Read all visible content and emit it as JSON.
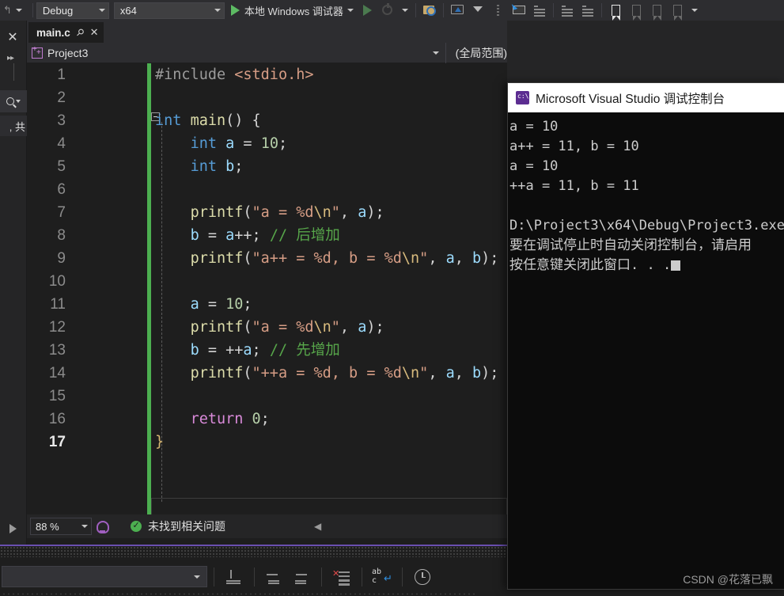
{
  "toolbar": {
    "configuration": "Debug",
    "platform": "x64",
    "debug_target": "本地 Windows 调试器",
    "icons": [
      "undo-icon",
      "redo-caret-icon",
      "start-debug-icon",
      "start-without-debug-icon",
      "stop-icon",
      "find-in-folder-icon",
      "preview-window-icon",
      "filter-icon",
      "more-dots-icon",
      "step-pointer-icon",
      "indent-block-icon",
      "align-left-icon",
      "outdent-icon",
      "bookmark-icon",
      "prev-bookmark-icon",
      "next-bookmark-icon",
      "clear-bookmarks-icon",
      "overflow-icon"
    ]
  },
  "left_rail": {
    "close_label": "✕",
    "expand_label": "▸▸",
    "search_icon": "search-icon",
    "cjk_fragment": ", 共"
  },
  "tab": {
    "filename": "main.c",
    "pin_icon": "pin-icon",
    "close_icon": "close-icon"
  },
  "navbar": {
    "project": "Project3",
    "scope": "(全局范围)"
  },
  "editor": {
    "line_numbers": [
      "1",
      "2",
      "3",
      "4",
      "5",
      "6",
      "7",
      "8",
      "9",
      "10",
      "11",
      "12",
      "13",
      "14",
      "15",
      "16",
      "17"
    ],
    "active_line": 17,
    "lines": [
      {
        "n": 1,
        "tokens": [
          {
            "t": "#include ",
            "c": "t-pre"
          },
          {
            "t": "<stdio.h>",
            "c": "t-hdr"
          }
        ]
      },
      {
        "n": 2,
        "tokens": []
      },
      {
        "n": 3,
        "tokens": [
          {
            "t": "int",
            "c": "t-kw"
          },
          {
            "t": " ",
            "c": "t-pun"
          },
          {
            "t": "main",
            "c": "t-fn"
          },
          {
            "t": "() {",
            "c": "t-pun"
          }
        ]
      },
      {
        "n": 4,
        "tokens": [
          {
            "t": "    ",
            "c": "t-pun"
          },
          {
            "t": "int",
            "c": "t-kw"
          },
          {
            "t": " ",
            "c": "t-pun"
          },
          {
            "t": "a",
            "c": "t-var"
          },
          {
            "t": " = ",
            "c": "t-pun"
          },
          {
            "t": "10",
            "c": "t-num"
          },
          {
            "t": ";",
            "c": "t-pun"
          }
        ]
      },
      {
        "n": 5,
        "tokens": [
          {
            "t": "    ",
            "c": "t-pun"
          },
          {
            "t": "int",
            "c": "t-kw"
          },
          {
            "t": " ",
            "c": "t-pun"
          },
          {
            "t": "b",
            "c": "t-var"
          },
          {
            "t": ";",
            "c": "t-pun"
          }
        ]
      },
      {
        "n": 6,
        "tokens": []
      },
      {
        "n": 7,
        "tokens": [
          {
            "t": "    ",
            "c": "t-pun"
          },
          {
            "t": "printf",
            "c": "t-fn"
          },
          {
            "t": "(",
            "c": "t-pun"
          },
          {
            "t": "\"a = %d",
            "c": "t-str"
          },
          {
            "t": "\\n",
            "c": "t-esc"
          },
          {
            "t": "\"",
            "c": "t-str"
          },
          {
            "t": ", ",
            "c": "t-pun"
          },
          {
            "t": "a",
            "c": "t-var"
          },
          {
            "t": ");",
            "c": "t-pun"
          }
        ]
      },
      {
        "n": 8,
        "tokens": [
          {
            "t": "    ",
            "c": "t-pun"
          },
          {
            "t": "b",
            "c": "t-var"
          },
          {
            "t": " = ",
            "c": "t-pun"
          },
          {
            "t": "a",
            "c": "t-var"
          },
          {
            "t": "++; ",
            "c": "t-pun"
          },
          {
            "t": "// 后增加",
            "c": "t-cmt"
          }
        ]
      },
      {
        "n": 9,
        "tokens": [
          {
            "t": "    ",
            "c": "t-pun"
          },
          {
            "t": "printf",
            "c": "t-fn"
          },
          {
            "t": "(",
            "c": "t-pun"
          },
          {
            "t": "\"a++ = %d, b = %d",
            "c": "t-str"
          },
          {
            "t": "\\n",
            "c": "t-esc"
          },
          {
            "t": "\"",
            "c": "t-str"
          },
          {
            "t": ", ",
            "c": "t-pun"
          },
          {
            "t": "a",
            "c": "t-var"
          },
          {
            "t": ", ",
            "c": "t-pun"
          },
          {
            "t": "b",
            "c": "t-var"
          },
          {
            "t": ");",
            "c": "t-pun"
          }
        ]
      },
      {
        "n": 10,
        "tokens": []
      },
      {
        "n": 11,
        "tokens": [
          {
            "t": "    ",
            "c": "t-pun"
          },
          {
            "t": "a",
            "c": "t-var"
          },
          {
            "t": " = ",
            "c": "t-pun"
          },
          {
            "t": "10",
            "c": "t-num"
          },
          {
            "t": ";",
            "c": "t-pun"
          }
        ]
      },
      {
        "n": 12,
        "tokens": [
          {
            "t": "    ",
            "c": "t-pun"
          },
          {
            "t": "printf",
            "c": "t-fn"
          },
          {
            "t": "(",
            "c": "t-pun"
          },
          {
            "t": "\"a = %d",
            "c": "t-str"
          },
          {
            "t": "\\n",
            "c": "t-esc"
          },
          {
            "t": "\"",
            "c": "t-str"
          },
          {
            "t": ", ",
            "c": "t-pun"
          },
          {
            "t": "a",
            "c": "t-var"
          },
          {
            "t": ");",
            "c": "t-pun"
          }
        ]
      },
      {
        "n": 13,
        "tokens": [
          {
            "t": "    ",
            "c": "t-pun"
          },
          {
            "t": "b",
            "c": "t-var"
          },
          {
            "t": " = ++",
            "c": "t-pun"
          },
          {
            "t": "a",
            "c": "t-var"
          },
          {
            "t": "; ",
            "c": "t-pun"
          },
          {
            "t": "// 先增加",
            "c": "t-cmt"
          }
        ]
      },
      {
        "n": 14,
        "tokens": [
          {
            "t": "    ",
            "c": "t-pun"
          },
          {
            "t": "printf",
            "c": "t-fn"
          },
          {
            "t": "(",
            "c": "t-pun"
          },
          {
            "t": "\"++a = %d, b = %d",
            "c": "t-str"
          },
          {
            "t": "\\n",
            "c": "t-esc"
          },
          {
            "t": "\"",
            "c": "t-str"
          },
          {
            "t": ", ",
            "c": "t-pun"
          },
          {
            "t": "a",
            "c": "t-var"
          },
          {
            "t": ", ",
            "c": "t-pun"
          },
          {
            "t": "b",
            "c": "t-var"
          },
          {
            "t": ");",
            "c": "t-pun"
          }
        ]
      },
      {
        "n": 15,
        "tokens": []
      },
      {
        "n": 16,
        "tokens": [
          {
            "t": "    ",
            "c": "t-pun"
          },
          {
            "t": "return",
            "c": "t-kw2"
          },
          {
            "t": " ",
            "c": "t-pun"
          },
          {
            "t": "0",
            "c": "t-num"
          },
          {
            "t": ";",
            "c": "t-pun"
          }
        ]
      },
      {
        "n": 17,
        "tokens": [
          {
            "t": "}",
            "c": "t-brace"
          }
        ]
      }
    ]
  },
  "status_bar": {
    "zoom": "88 %",
    "intellicode_icon": "brain-icon",
    "issue_icon": "check-circle-icon",
    "issue_text": "未找到相关问题",
    "scroll_left_icon": "left-arrow-icon"
  },
  "bottom_bar": {
    "dropdown_value": "",
    "icons": [
      "indent-down-icon",
      "outdent-left-icon",
      "indent-right-icon",
      "clear-all-icon",
      "word-wrap-icon",
      "history-clock-icon"
    ]
  },
  "console": {
    "icon": "console-app-icon",
    "title": "Microsoft Visual Studio 调试控制台",
    "output": [
      "a = 10",
      "a++ = 11, b = 10",
      "a = 10",
      "++a = 11, b = 11",
      "",
      "D:\\Project3\\x64\\Debug\\Project3.exe",
      "要在调试停止时自动关闭控制台，请启用",
      "按任意键关闭此窗口. . ."
    ]
  },
  "watermark": "CSDN @花落已飘",
  "colors": {
    "editor_bg": "#1e1e1e",
    "chrome_bg": "#2d2d30",
    "accent_green": "#4caf50",
    "accent_purple": "#6a4fb0",
    "console_bg": "#0c0c0c"
  }
}
